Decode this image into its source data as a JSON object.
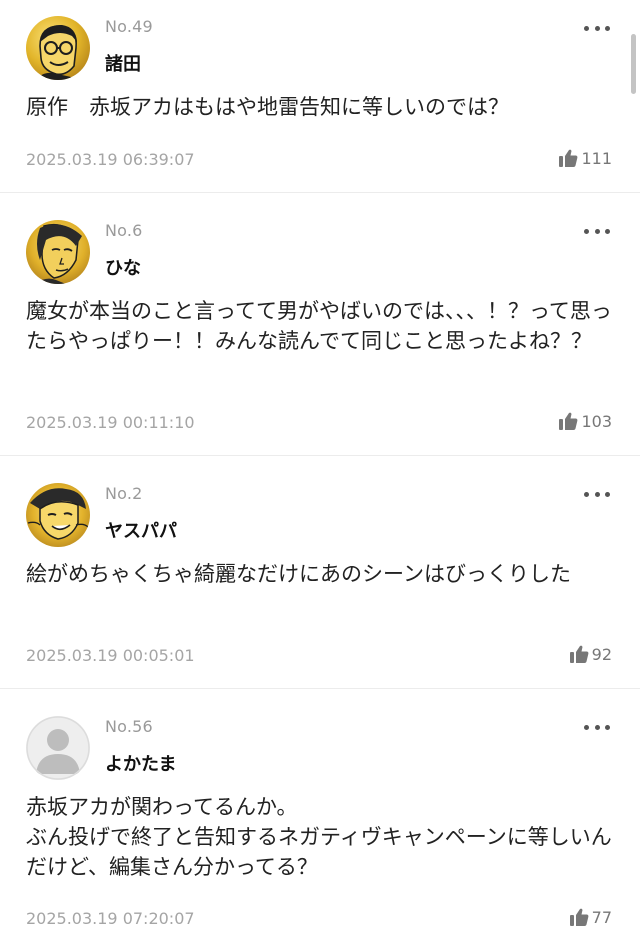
{
  "comments": [
    {
      "number": "No.49",
      "name": "諸田",
      "text": "原作　赤坂アカはもはや地雷告知に等しいのでは？",
      "timestamp": "2025.03.19 06:39:07",
      "likes": "111",
      "avatar": "gold-cartoon-face-glasses"
    },
    {
      "number": "No.6",
      "name": "ひな",
      "text": "魔女が本当のこと言ってて男がやばいのでは、、、！？って思ったらやっぱりー！！みんな読んでて同じこと思ったよね？？",
      "timestamp": "2025.03.19 00:11:10",
      "likes": "103",
      "avatar": "gold-manga-face"
    },
    {
      "number": "No.2",
      "name": "ヤスパパ",
      "text": "絵がめちゃくちゃ綺麗なだけにあのシーンはびっくりした",
      "timestamp": "2025.03.19 00:05:01",
      "likes": "92",
      "avatar": "gold-manga-face-smiling"
    },
    {
      "number": "No.56",
      "name": "よかたま",
      "text": "赤坂アカが関わってるんか。\nぶん投げで終了と告知するネガティヴキャンペーンに等しいんだけど、編集さん分かってる？",
      "timestamp": "2025.03.19 07:20:07",
      "likes": "77",
      "avatar": "default-gray-user"
    }
  ],
  "icons": {
    "more": "more-options-icon",
    "like": "thumbs-up-icon"
  },
  "colors": {
    "gold": "#e2b52a",
    "meta_gray": "#a5a5a5",
    "text": "#222222"
  }
}
